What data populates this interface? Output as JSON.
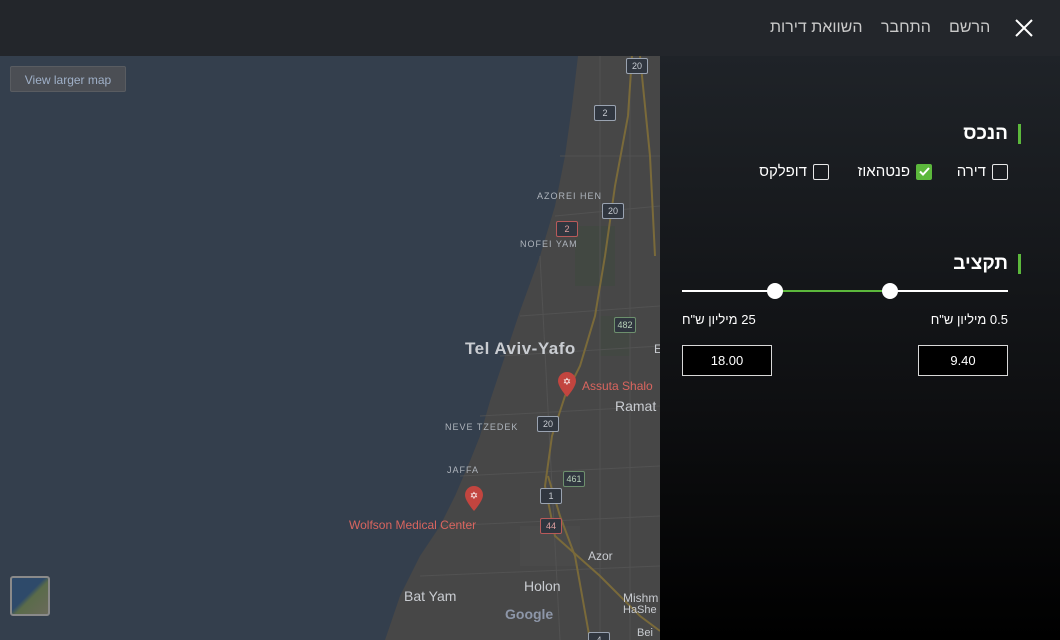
{
  "topbar": {
    "nav_register": "הרשם",
    "nav_login": "התחבר",
    "nav_compare": "השוואת דירות"
  },
  "map": {
    "view_larger_label": "View larger map",
    "places": {
      "city": "Tel Aviv-Yafo",
      "azorei_hen": "AZOREI HEN",
      "nofei_yam": "NOFEI YAM",
      "neve_tzedek": "NEVE TZEDEK",
      "jaffa": "JAFFA",
      "assuta": "Assuta Shalo",
      "ramat": "Ramat",
      "wolfson": "Wolfson Medical Center",
      "holon": "Holon",
      "azor": "Azor",
      "bat_yam": "Bat Yam",
      "mishm": "Mishm",
      "hashm": "HaShe",
      "bei": "Bei",
      "google": "Google",
      "e_label": "E"
    },
    "shields": {
      "r20a": "20",
      "r2a": "2",
      "r20b": "20",
      "r2b": "2",
      "r482": "482",
      "r20c": "20",
      "r461": "461",
      "r1": "1",
      "r44": "44",
      "r4": "4"
    }
  },
  "panel": {
    "property_title": "הנכס",
    "types": [
      {
        "label": "דירה",
        "checked": false
      },
      {
        "label": "פנטהאוז",
        "checked": true
      },
      {
        "label": "דופלקס",
        "checked": false
      }
    ],
    "budget_title": "תקציב",
    "min_label": "0.5 מיליון ש\"ח",
    "max_label": "25 מיליון ש\"ח",
    "min_value": "9.40",
    "max_value": "18.00"
  },
  "colors": {
    "accent": "#5cb83c",
    "sea": "#343f4d",
    "land": "#474747"
  }
}
